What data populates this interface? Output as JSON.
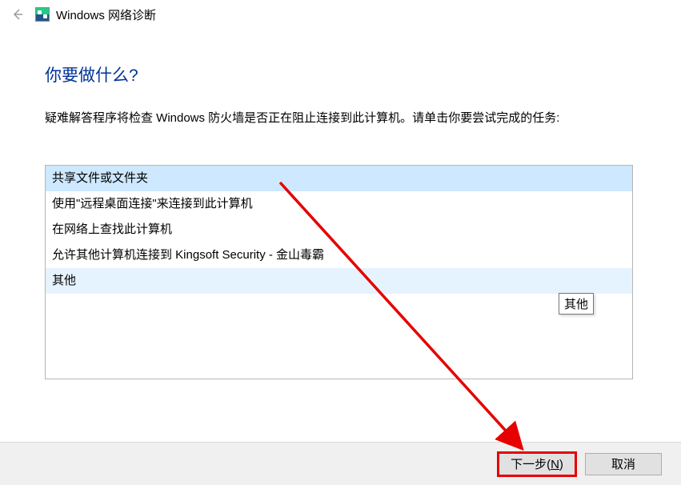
{
  "header": {
    "title": "Windows 网络诊断"
  },
  "main": {
    "heading": "你要做什么?",
    "description": "疑难解答程序将检查 Windows 防火墙是否正在阻止连接到此计算机。请单击你要尝试完成的任务:"
  },
  "list": {
    "items": [
      {
        "label": "共享文件或文件夹",
        "state": "selected"
      },
      {
        "label": "使用\"远程桌面连接\"来连接到此计算机",
        "state": ""
      },
      {
        "label": "在网络上查找此计算机",
        "state": ""
      },
      {
        "label": "允许其他计算机连接到 Kingsoft Security - 金山毒霸",
        "state": ""
      },
      {
        "label": "其他",
        "state": "hover"
      }
    ]
  },
  "tooltip": {
    "text": "其他"
  },
  "footer": {
    "next_label_pre": "下一步(",
    "next_label_u": "N",
    "next_label_post": ")",
    "cancel_label": "取消"
  }
}
